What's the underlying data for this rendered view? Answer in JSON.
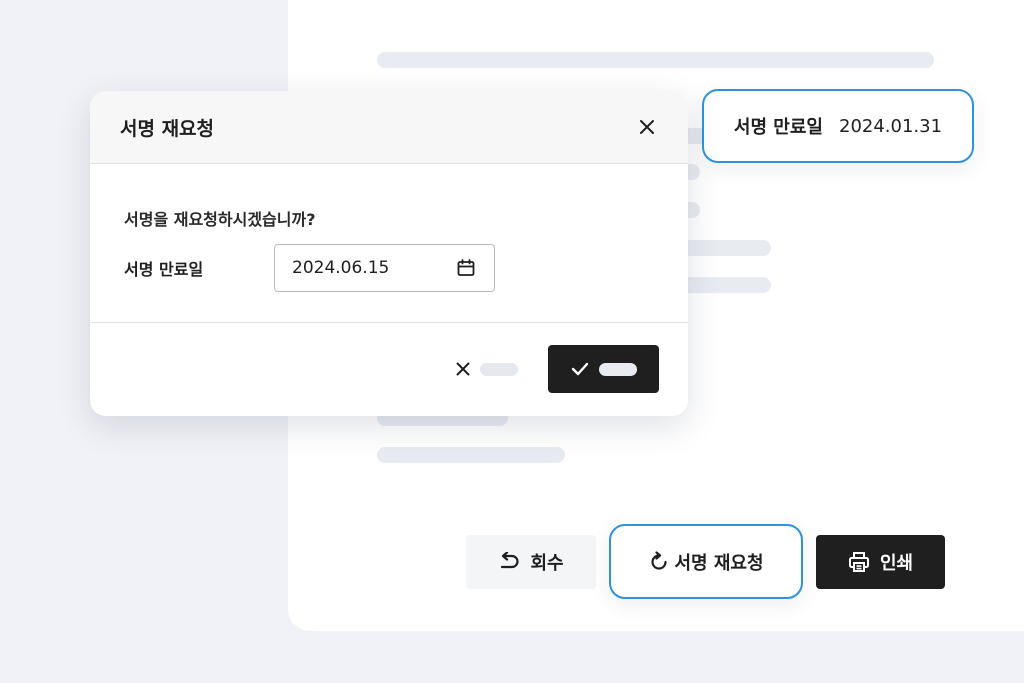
{
  "expiry_callout": {
    "label": "서명 만료일",
    "value": "2024.01.31"
  },
  "dialog": {
    "title": "서명 재요청",
    "question": "서명을 재요청하시겠습니까?",
    "expiry_field": {
      "label": "서명 만료일",
      "value": "2024.06.15"
    }
  },
  "actions": {
    "retrieve_label": "회수",
    "rerequest_label": "서명 재요청",
    "print_label": "인쇄"
  },
  "colors": {
    "accent": "#2d93e0",
    "primary_dark": "#1f1f1f",
    "background": "#f1f2f7"
  },
  "icons": [
    "close-icon",
    "calendar-icon",
    "check-icon",
    "undo-icon",
    "refresh-icon",
    "printer-icon"
  ]
}
